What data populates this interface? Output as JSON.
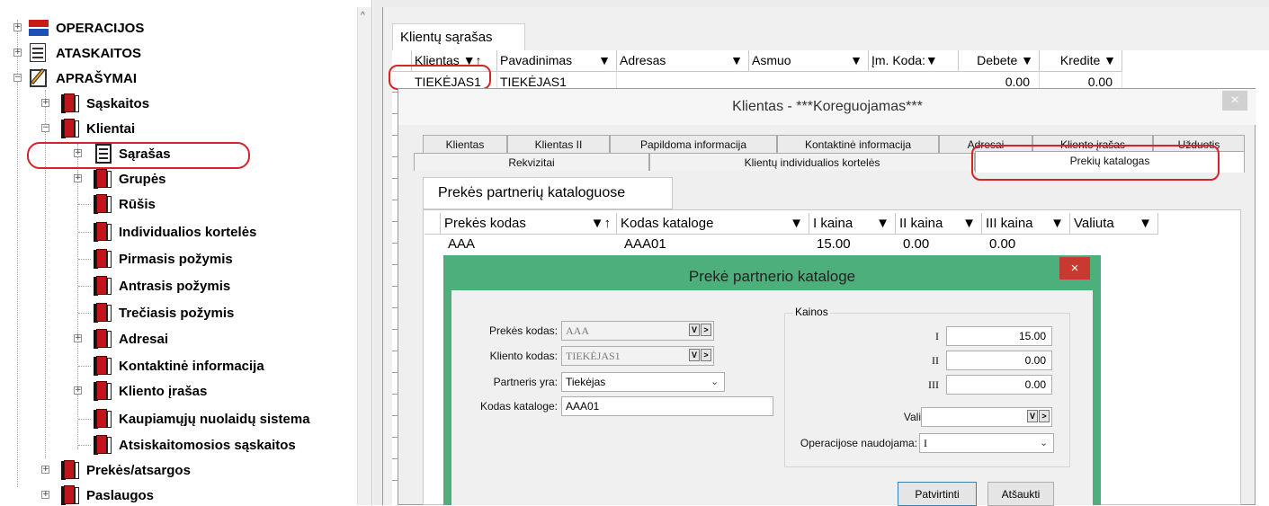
{
  "tree": {
    "operacijos": "OPERACIJOS",
    "ataskaitos": "ATASKAITOS",
    "aprasymai": "APRAŠYMAI",
    "saskaitos": "Sąskaitos",
    "klientai": "Klientai",
    "sarasas": "Sąrašas",
    "grupes": "Grupės",
    "rusis": "Rūšis",
    "individualios": "Individualios kortelės",
    "pirmasis": "Pirmasis požymis",
    "antrasis": "Antrasis požymis",
    "treciasis": "Trečiasis požymis",
    "adresai": "Adresai",
    "kontaktine": "Kontaktinė informacija",
    "kliento_irasas": "Kliento įrašas",
    "kaupiamuju": "Kaupiamųjų nuolaidų sistema",
    "atsiskaitomosios": "Atsiskaitomosios sąskaitos",
    "prekes": "Prekės/atsargos",
    "paslaugos": "Paslaugos"
  },
  "list": {
    "tab": "Klientų sąrašas",
    "headers": [
      "Klientas ▼↑",
      "Pavadinimas",
      "▼",
      "Adresas",
      "▼",
      "Asmuo",
      "▼",
      "Įm. Koda:▼",
      "Debete ▼",
      "Kredite ▼"
    ],
    "row": {
      "klientas": "TIEKĖJAS1",
      "pavadinimas": "TIEKĖJAS1",
      "debete": "0.00",
      "kredite": "0.00"
    }
  },
  "dialog1": {
    "title": "Klientas - ***Koreguojamas***",
    "close": "×",
    "tabs1": [
      "Klientas",
      "Klientas II",
      "Papildoma informacija",
      "Kontaktinė informacija",
      "Adresai",
      "Kliento įrašas",
      "Užduotis"
    ],
    "tabs2": [
      "Rekvizitai",
      "Klientų individualios kortelės",
      "Prekių katalogas"
    ],
    "subtab": "Prekės partnerių kataloguose",
    "headers": [
      "Prekės kodas",
      "▼↑",
      "Kodas kataloge",
      "▼",
      "I kaina",
      "▼",
      "II kaina",
      "▼",
      "III kaina",
      "▼",
      "Valiuta",
      "▼"
    ],
    "row": {
      "prekes_kodas": "AAA",
      "kodas_kataloge": "AAA01",
      "i": "15.00",
      "ii": "0.00",
      "iii": "0.00"
    }
  },
  "dialog2": {
    "title": "Prekė partnerio kataloge",
    "close": "×",
    "prekes_kodas_label": "Prekės kodas:",
    "prekes_kodas_value": "AAA",
    "kliento_kodas_label": "Kliento kodas:",
    "kliento_kodas_value": "TIEKĖJAS1",
    "partneris_label": "Partneris yra:",
    "partneris_value": "Tiekėjas",
    "kodas_kataloge_label": "Kodas kataloge:",
    "kodas_kataloge_value": "AAA01",
    "kainos_label": "Kainos",
    "i_label": "I",
    "i_value": "15.00",
    "ii_label": "II",
    "ii_value": "0.00",
    "iii_label": "III",
    "iii_value": "0.00",
    "valiuta_label": "Valiuta:",
    "valiuta_value": "",
    "operacijose_label": "Operacijose naudojama:",
    "operacijose_value": "I",
    "confirm": "Patvirtinti",
    "cancel": "Atšaukti",
    "btn_v": "V",
    "btn_gt": ">"
  },
  "colors": {
    "accent_red": "#d4242a",
    "dialog_green": "#4db07c",
    "close_red": "#c8392f"
  }
}
